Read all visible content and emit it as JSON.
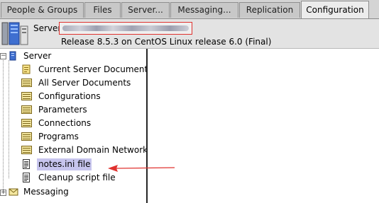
{
  "tabs": [
    {
      "label": "People & Groups",
      "active": false
    },
    {
      "label": "Files",
      "active": false
    },
    {
      "label": "Server...",
      "active": false
    },
    {
      "label": "Messaging...",
      "active": false
    },
    {
      "label": "Replication",
      "active": false
    },
    {
      "label": "Configuration",
      "active": true
    }
  ],
  "header": {
    "server_label": "Server",
    "server_name_redacted": true,
    "release_text": "Release 8.5.3 on CentOS Linux release 6.0 (Final)",
    "highlight_color": "#e0322f"
  },
  "tree": {
    "root_server": {
      "label": "Server",
      "icon": "server-icon",
      "expander": "−"
    },
    "items": [
      {
        "label": "Current Server Document",
        "icon": "document-icon"
      },
      {
        "label": "All Server Documents",
        "icon": "view-list-icon"
      },
      {
        "label": "Configurations",
        "icon": "view-list-icon"
      },
      {
        "label": "Parameters",
        "icon": "view-list-icon"
      },
      {
        "label": "Connections",
        "icon": "view-list-icon"
      },
      {
        "label": "Programs",
        "icon": "view-list-icon"
      },
      {
        "label": "External Domain Network Ir",
        "icon": "view-list-icon"
      },
      {
        "label": "notes.ini file",
        "icon": "notes-file-icon",
        "selected": true
      },
      {
        "label": "Cleanup script file",
        "icon": "notes-file-icon"
      }
    ],
    "root_messaging": {
      "label": "Messaging",
      "icon": "messaging-icon",
      "expander": "+"
    }
  },
  "annotation": {
    "arrow_color": "#e0322f",
    "points_to": "notes.ini file"
  },
  "colors": {
    "selection": "#c7c5ee",
    "tabbar": "#d4d4d4",
    "header": "#e3e3e3"
  }
}
